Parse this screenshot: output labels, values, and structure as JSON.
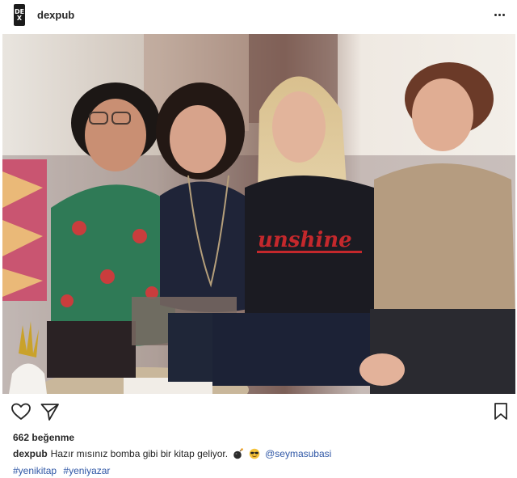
{
  "header": {
    "avatar_text_top": "DE",
    "avatar_text_bottom": "X",
    "username": "dexpub",
    "more_icon": "more-horizontal-icon"
  },
  "photo": {
    "alt": "",
    "shirt_text": "unshine"
  },
  "actions": {
    "like_icon": "heart-icon",
    "share_icon": "send-icon",
    "save_icon": "bookmark-icon"
  },
  "likes": {
    "count": "662",
    "label": "beğenme"
  },
  "caption": {
    "username": "dexpub",
    "text": "Hazır mısınız bomba gibi bir kitap geliyor.",
    "emoji_1": "bomb-emoji",
    "emoji_2": "sunglasses-emoji",
    "mention": "@seymasubasi"
  },
  "hashtags": [
    "#yenikitap",
    "#yeniyazar"
  ],
  "colors": {
    "text": "#262626",
    "link": "#2f57a6"
  }
}
